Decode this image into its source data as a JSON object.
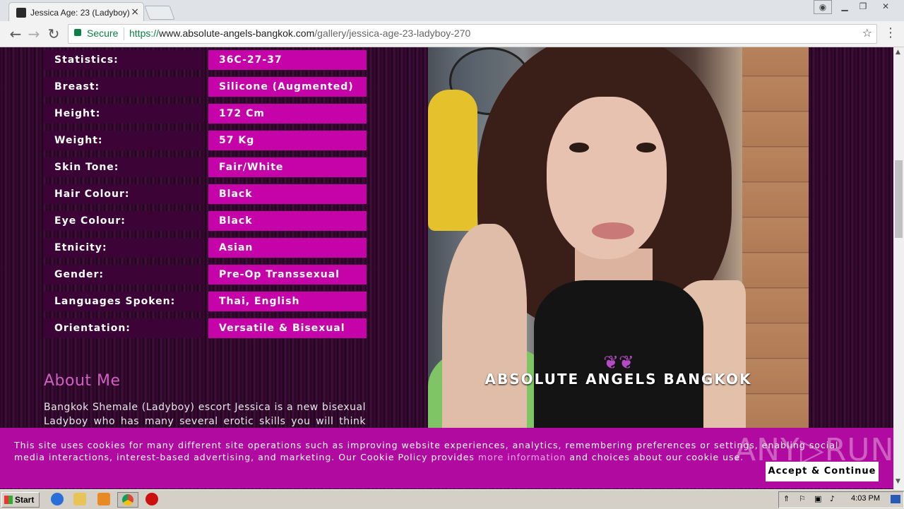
{
  "browser": {
    "tab_title": "Jessica Age: 23 (Ladyboy)",
    "tab_close": "×",
    "secure_label": "Secure",
    "url_protocol": "https://",
    "url_host": "www.absolute-angels-bangkok.com",
    "url_path": "/gallery/jessica-age-23-ladyboy-270",
    "back_glyph": "←",
    "forward_glyph": "→",
    "reload_glyph": "↻",
    "star_glyph": "☆",
    "menu_glyph": "⋮"
  },
  "profile": {
    "rows": [
      {
        "label": "Statistics:",
        "value": "36C-27-37"
      },
      {
        "label": "Breast:",
        "value": "Silicone (Augmented)"
      },
      {
        "label": "Height:",
        "value": "172 Cm"
      },
      {
        "label": "Weight:",
        "value": "57 Kg"
      },
      {
        "label": "Skin Tone:",
        "value": "Fair/White"
      },
      {
        "label": "Hair Colour:",
        "value": "Black"
      },
      {
        "label": "Eye Colour:",
        "value": "Black"
      },
      {
        "label": "Etnicity:",
        "value": "Asian"
      },
      {
        "label": "Gender:",
        "value": "Pre-Op Transsexual"
      },
      {
        "label": "Languages Spoken:",
        "value": "Thai, English"
      },
      {
        "label": "Orientation:",
        "value": "Versatile & Bisexual"
      }
    ],
    "about_title": "About Me",
    "about_text": "Bangkok Shemale (Ladyboy) escort Jessica is a new bisexual Ladyboy who has many several erotic skills you will think she"
  },
  "photo": {
    "watermark": "ABSOLUTE ANGELS BANGKOK"
  },
  "cookie": {
    "text_before": "This site uses cookies for many different site operations such as improving website experiences, analytics, remembering preferences or settings, enabling social media interactions, interest-based advertising, and marketing. Our Cookie Policy provides ",
    "link": "more information",
    "text_after": " and choices about our cookie use.",
    "accept": "Accept & Continue",
    "overlay": "ANY▷RUN"
  },
  "taskbar": {
    "start": "Start",
    "clock": "4:03 PM"
  },
  "colors": {
    "label_bg": "#3c0337",
    "value_bg": "#c603a8",
    "cookie_bg": "#b10aa0",
    "title_color": "#d060c0"
  }
}
